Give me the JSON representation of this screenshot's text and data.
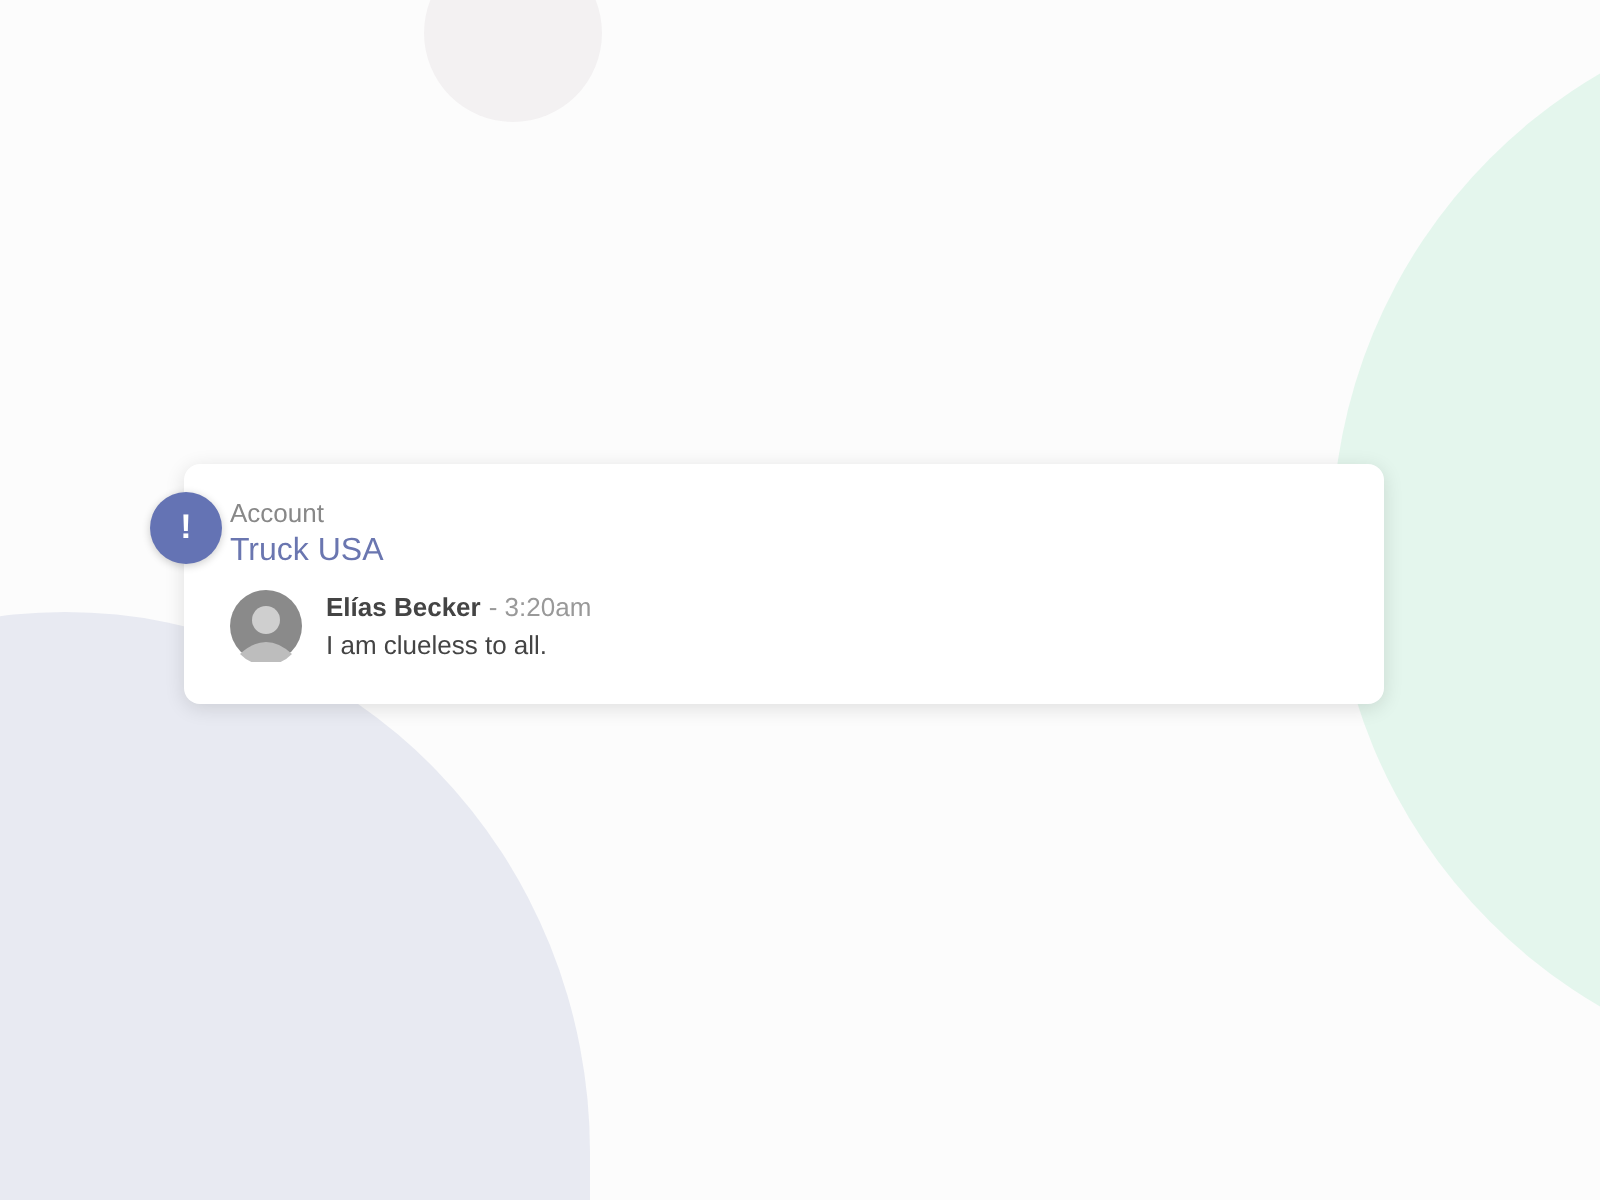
{
  "notification": {
    "badge": "!",
    "label": "Account",
    "title": "Truck USA",
    "comment": {
      "author": "Elías Becker",
      "separator": "-",
      "time": "3:20am",
      "text": "I am clueless to all."
    }
  }
}
